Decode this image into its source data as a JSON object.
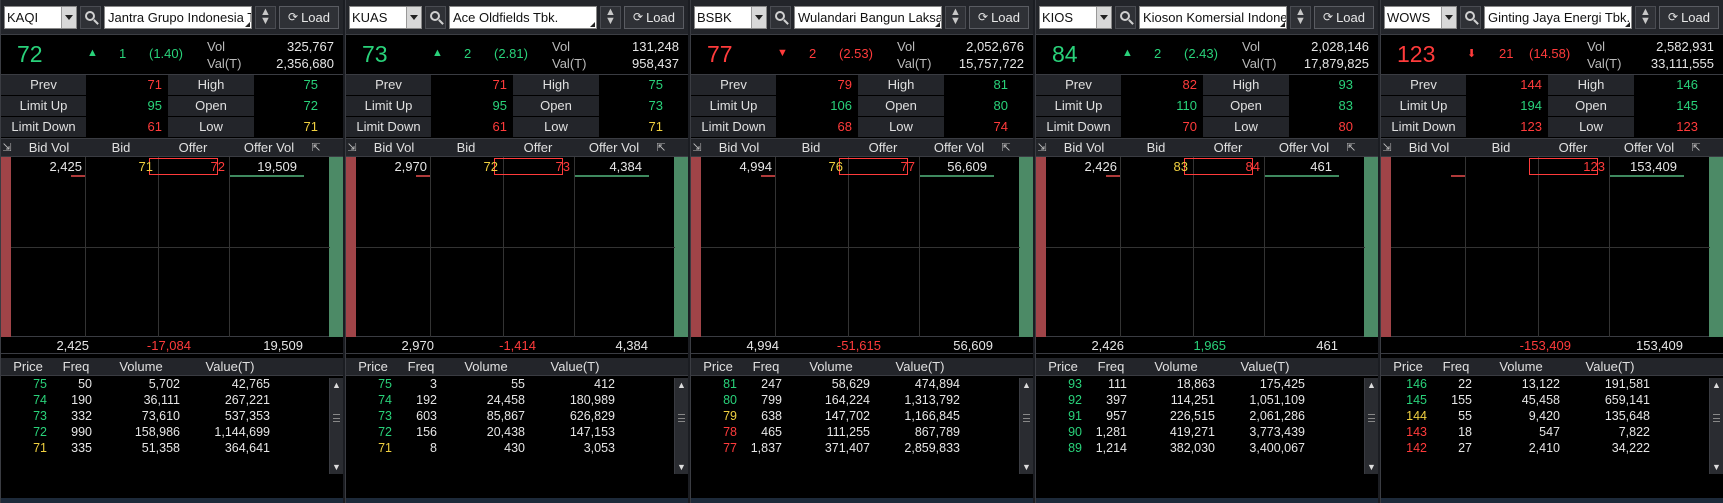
{
  "ui": {
    "load_label": "Load",
    "labels": {
      "vol": "Vol",
      "val": "Val(T)",
      "prev": "Prev",
      "high": "High",
      "limit_up": "Limit Up",
      "open": "Open",
      "limit_down": "Limit Down",
      "low": "Low"
    },
    "book_headers": [
      "Bid Vol",
      "Bid",
      "Offer",
      "Offer Vol"
    ],
    "trade_headers": [
      "Price",
      "Freq",
      "Volume",
      "Value(T)"
    ],
    "colors": {
      "up": "#29d27a",
      "down": "#ff3b3b",
      "unchanged": "#f0d040",
      "panel_bg": "#000000",
      "header_bg": "#23252a"
    }
  },
  "panels": [
    {
      "code": "KAQI",
      "name": "Jantra Grupo Indonesia T",
      "last": "72",
      "dir": "up",
      "arrow": "▲",
      "change": "1",
      "pct": "(1.40)",
      "vol": "325,767",
      "val": "2,356,680",
      "prev": "71",
      "high": "75",
      "limit_up": "95",
      "open": "72",
      "limit_down": "61",
      "low": "71",
      "book": {
        "bid_vol": "2,425",
        "bid": "71",
        "offer": "72",
        "offer_vol": "19,509"
      },
      "totals": {
        "bid_vol": "2,425",
        "net": "-17,084",
        "offer_vol": "19,509",
        "net_dir": "down"
      },
      "trades": [
        {
          "price": "75",
          "freq": "50",
          "volume": "5,702",
          "value": "42,765",
          "c": "up"
        },
        {
          "price": "74",
          "freq": "190",
          "volume": "36,111",
          "value": "267,221",
          "c": "up"
        },
        {
          "price": "73",
          "freq": "332",
          "volume": "73,610",
          "value": "537,353",
          "c": "up"
        },
        {
          "price": "72",
          "freq": "990",
          "volume": "158,986",
          "value": "1,144,699",
          "c": "up"
        },
        {
          "price": "71",
          "freq": "335",
          "volume": "51,358",
          "value": "364,641",
          "c": "eq"
        }
      ]
    },
    {
      "code": "KUAS",
      "name": "Ace Oldfields Tbk.",
      "last": "73",
      "dir": "up",
      "arrow": "▲",
      "change": "2",
      "pct": "(2.81)",
      "vol": "131,248",
      "val": "958,437",
      "prev": "71",
      "high": "75",
      "limit_up": "95",
      "open": "73",
      "limit_down": "61",
      "low": "71",
      "book": {
        "bid_vol": "2,970",
        "bid": "72",
        "offer": "73",
        "offer_vol": "4,384"
      },
      "totals": {
        "bid_vol": "2,970",
        "net": "-1,414",
        "offer_vol": "4,384",
        "net_dir": "down"
      },
      "trades": [
        {
          "price": "75",
          "freq": "3",
          "volume": "55",
          "value": "412",
          "c": "up"
        },
        {
          "price": "74",
          "freq": "192",
          "volume": "24,458",
          "value": "180,989",
          "c": "up"
        },
        {
          "price": "73",
          "freq": "603",
          "volume": "85,867",
          "value": "626,829",
          "c": "up"
        },
        {
          "price": "72",
          "freq": "156",
          "volume": "20,438",
          "value": "147,153",
          "c": "up"
        },
        {
          "price": "71",
          "freq": "8",
          "volume": "430",
          "value": "3,053",
          "c": "eq"
        }
      ]
    },
    {
      "code": "BSBK",
      "name": "Wulandari Bangun Laksa",
      "last": "77",
      "dir": "down",
      "arrow": "▼",
      "change": "2",
      "pct": "(2.53)",
      "vol": "2,052,676",
      "val": "15,757,722",
      "prev": "79",
      "high": "81",
      "limit_up": "106",
      "open": "80",
      "limit_down": "68",
      "low": "74",
      "book": {
        "bid_vol": "4,994",
        "bid": "76",
        "offer": "77",
        "offer_vol": "56,609"
      },
      "totals": {
        "bid_vol": "4,994",
        "net": "-51,615",
        "offer_vol": "56,609",
        "net_dir": "down"
      },
      "trades": [
        {
          "price": "81",
          "freq": "247",
          "volume": "58,629",
          "value": "474,894",
          "c": "up"
        },
        {
          "price": "80",
          "freq": "799",
          "volume": "164,224",
          "value": "1,313,792",
          "c": "up"
        },
        {
          "price": "79",
          "freq": "638",
          "volume": "147,702",
          "value": "1,166,845",
          "c": "eq"
        },
        {
          "price": "78",
          "freq": "465",
          "volume": "111,255",
          "value": "867,789",
          "c": "down"
        },
        {
          "price": "77",
          "freq": "1,837",
          "volume": "371,407",
          "value": "2,859,833",
          "c": "down"
        }
      ]
    },
    {
      "code": "KIOS",
      "name": "Kioson Komersial Indone",
      "last": "84",
      "dir": "up",
      "arrow": "▲",
      "change": "2",
      "pct": "(2.43)",
      "vol": "2,028,146",
      "val": "17,879,825",
      "prev": "82",
      "high": "93",
      "limit_up": "110",
      "open": "83",
      "limit_down": "70",
      "low": "80",
      "book": {
        "bid_vol": "2,426",
        "bid": "83",
        "offer": "84",
        "offer_vol": "461"
      },
      "totals": {
        "bid_vol": "2,426",
        "net": "1,965",
        "offer_vol": "461",
        "net_dir": "up"
      },
      "trades": [
        {
          "price": "93",
          "freq": "111",
          "volume": "18,863",
          "value": "175,425",
          "c": "up"
        },
        {
          "price": "92",
          "freq": "397",
          "volume": "114,251",
          "value": "1,051,109",
          "c": "up"
        },
        {
          "price": "91",
          "freq": "957",
          "volume": "226,515",
          "value": "2,061,286",
          "c": "up"
        },
        {
          "price": "90",
          "freq": "1,281",
          "volume": "419,271",
          "value": "3,773,439",
          "c": "up"
        },
        {
          "price": "89",
          "freq": "1,214",
          "volume": "382,030",
          "value": "3,400,067",
          "c": "up"
        }
      ]
    },
    {
      "code": "WOWS",
      "name": "Ginting Jaya Energi Tbk.",
      "last": "123",
      "dir": "down",
      "arrow": "⬇",
      "change": "21",
      "pct": "(14.58)",
      "vol": "2,582,931",
      "val": "33,111,555",
      "prev": "144",
      "high": "146",
      "limit_up": "194",
      "open": "145",
      "limit_down": "123",
      "low": "123",
      "book": {
        "bid_vol": "",
        "bid": "",
        "offer": "123",
        "offer_vol": "153,409"
      },
      "totals": {
        "bid_vol": "",
        "net": "-153,409",
        "offer_vol": "153,409",
        "net_dir": "down"
      },
      "trades": [
        {
          "price": "146",
          "freq": "22",
          "volume": "13,122",
          "value": "191,581",
          "c": "up"
        },
        {
          "price": "145",
          "freq": "155",
          "volume": "45,458",
          "value": "659,141",
          "c": "up"
        },
        {
          "price": "144",
          "freq": "55",
          "volume": "9,420",
          "value": "135,648",
          "c": "eq"
        },
        {
          "price": "143",
          "freq": "18",
          "volume": "547",
          "value": "7,822",
          "c": "down"
        },
        {
          "price": "142",
          "freq": "27",
          "volume": "2,410",
          "value": "34,222",
          "c": "down"
        }
      ]
    }
  ]
}
